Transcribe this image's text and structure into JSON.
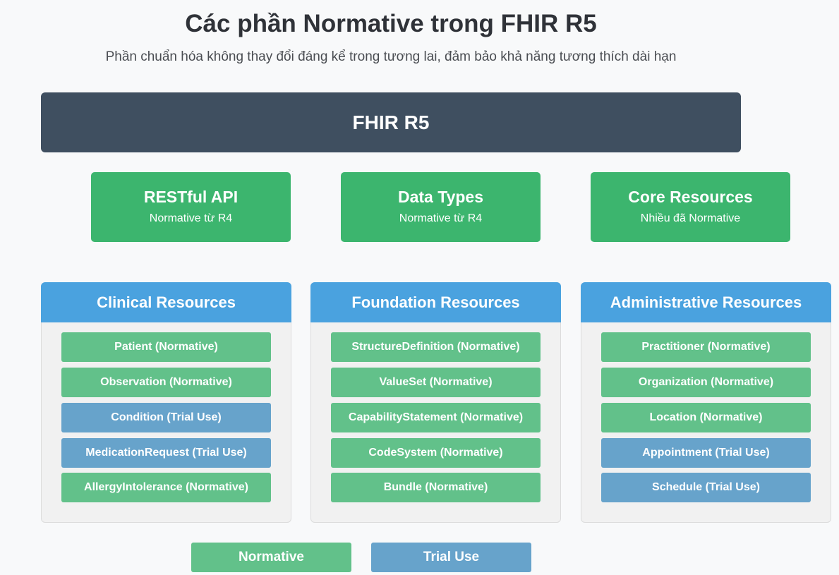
{
  "header": {
    "title": "Các phần Normative trong FHIR R5",
    "subtitle": "Phần chuẩn hóa không thay đổi đáng kể trong tương lai, đảm bảo khả năng tương thích dài hạn"
  },
  "root": {
    "label": "FHIR R5"
  },
  "top_cards": [
    {
      "title": "RESTful API",
      "subtitle": "Normative từ R4"
    },
    {
      "title": "Data Types",
      "subtitle": "Normative từ R4"
    },
    {
      "title": "Core Resources",
      "subtitle": "Nhiều đã Normative"
    }
  ],
  "panels": [
    {
      "title": "Clinical Resources",
      "items": [
        {
          "label": "Patient (Normative)",
          "status": "normative"
        },
        {
          "label": "Observation (Normative)",
          "status": "normative"
        },
        {
          "label": "Condition (Trial Use)",
          "status": "trial"
        },
        {
          "label": "MedicationRequest (Trial Use)",
          "status": "trial"
        },
        {
          "label": "AllergyIntolerance (Normative)",
          "status": "normative"
        }
      ]
    },
    {
      "title": "Foundation Resources",
      "items": [
        {
          "label": "StructureDefinition (Normative)",
          "status": "normative"
        },
        {
          "label": "ValueSet (Normative)",
          "status": "normative"
        },
        {
          "label": "CapabilityStatement (Normative)",
          "status": "normative"
        },
        {
          "label": "CodeSystem (Normative)",
          "status": "normative"
        },
        {
          "label": "Bundle (Normative)",
          "status": "normative"
        }
      ]
    },
    {
      "title": "Administrative Resources",
      "items": [
        {
          "label": "Practitioner (Normative)",
          "status": "normative"
        },
        {
          "label": "Organization (Normative)",
          "status": "normative"
        },
        {
          "label": "Location (Normative)",
          "status": "normative"
        },
        {
          "label": "Appointment (Trial Use)",
          "status": "trial"
        },
        {
          "label": "Schedule (Trial Use)",
          "status": "trial"
        }
      ]
    }
  ],
  "legend": {
    "normative": "Normative",
    "trial": "Trial Use"
  },
  "colors": {
    "root": "#3f4f60",
    "top_card": "#3cb56e",
    "panel_header": "#4aa2df",
    "normative": "#62c18a",
    "trial_use": "#67a3cb"
  }
}
